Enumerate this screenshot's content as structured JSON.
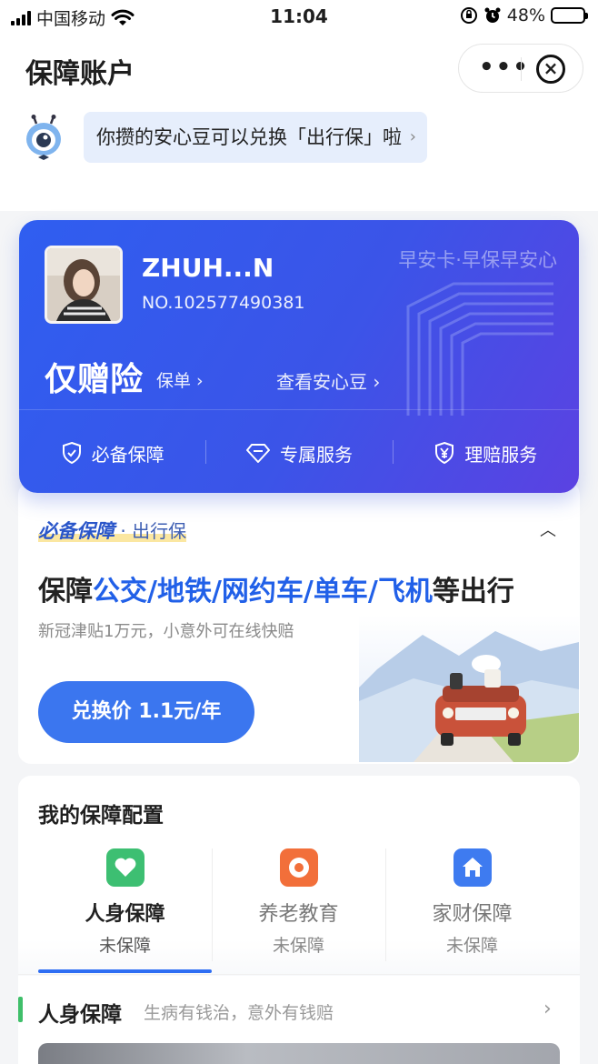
{
  "status_bar": {
    "carrier": "中国移动",
    "time": "11:04",
    "battery": "48%",
    "battery_level": 0.48
  },
  "header": {
    "title": "保障账户",
    "more_glyph": "•••",
    "close_glyph": "×"
  },
  "tip": {
    "text": "你攒的安心豆可以兑换「出行保」啦",
    "arrow": "›"
  },
  "card": {
    "user_name": "ZHUH...N",
    "user_no": "NO.102577490381",
    "brand": "早安卡·早保早安心",
    "insurance_title": "仅赠险",
    "policy_link": "保单 ›",
    "beans_link": "查看安心豆 ›",
    "services": [
      {
        "label": "必备保障",
        "icon": "shield-check-icon"
      },
      {
        "label": "专属服务",
        "icon": "diamond-icon"
      },
      {
        "label": "理赔服务",
        "icon": "yen-shield-icon"
      }
    ]
  },
  "promo": {
    "tag": "必备保障",
    "dot": " · ",
    "tag_sub": "出行保",
    "collapse_glyph": "︿",
    "title_prefix": "保障",
    "title_highlight": "公交/地铁/网约车/单车/飞机",
    "title_suffix": "等出行",
    "desc": "新冠津贴1万元，小意外可在线快赔",
    "button_label": "兑换价 1.1元/年"
  },
  "config": {
    "title": "我的保障配置",
    "tabs": [
      {
        "label": "人身保障",
        "status": "未保障",
        "icon": "heart-icon",
        "color": "#3dbf72"
      },
      {
        "label": "养老教育",
        "status": "未保障",
        "icon": "coin-icon",
        "color": "#f26f3a"
      },
      {
        "label": "家财保障",
        "status": "未保障",
        "icon": "home-icon",
        "color": "#3e7bf0"
      }
    ],
    "active_tab": 0,
    "section": {
      "title": "人身保障",
      "subtitle": "生病有钱治，意外有钱赔",
      "arrow": "›"
    }
  },
  "colors": {
    "accent_blue": "#2160e8",
    "button_blue": "#3b76ef",
    "card_gradient_start": "#2f5ef0",
    "card_gradient_end": "#5b42e2",
    "section_bar_green": "#3fbf6a"
  }
}
